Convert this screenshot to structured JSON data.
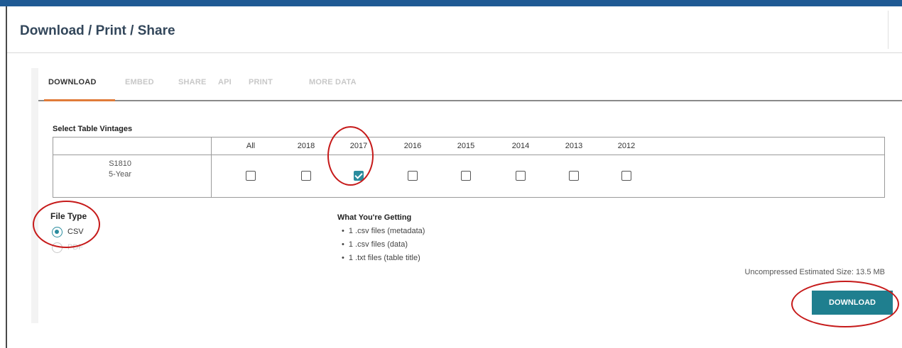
{
  "header": {
    "title": "Download / Print / Share"
  },
  "tabs": [
    {
      "label": "DOWNLOAD",
      "active": true
    },
    {
      "label": "EMBED",
      "active": false
    },
    {
      "label": "SHARE",
      "active": false
    },
    {
      "label": "API",
      "active": false
    },
    {
      "label": "PRINT",
      "active": false
    },
    {
      "label": "MORE DATA",
      "active": false
    }
  ],
  "vintages": {
    "label": "Select Table Vintages",
    "columns": [
      "All",
      "2018",
      "2017",
      "2016",
      "2015",
      "2014",
      "2013",
      "2012"
    ],
    "row": {
      "table_id": "S1810",
      "estimate": "5-Year",
      "checked": [
        false,
        false,
        true,
        false,
        false,
        false,
        false,
        false
      ]
    }
  },
  "file_type": {
    "label": "File Type",
    "options": [
      {
        "label": "CSV",
        "selected": true,
        "enabled": true
      },
      {
        "label": "PDF",
        "selected": false,
        "enabled": false
      }
    ]
  },
  "getting": {
    "title": "What You're Getting",
    "items": [
      "1 .csv files (metadata)",
      "1 .csv files (data)",
      "1 .txt files (table title)"
    ]
  },
  "size_text": "Uncompressed Estimated Size: 13.5 MB",
  "download_button": "DOWNLOAD",
  "colors": {
    "accent": "#1f7f8f",
    "topbar": "#1f5a94",
    "tab_underline": "#e07b39",
    "annotation": "#c61a1a"
  }
}
